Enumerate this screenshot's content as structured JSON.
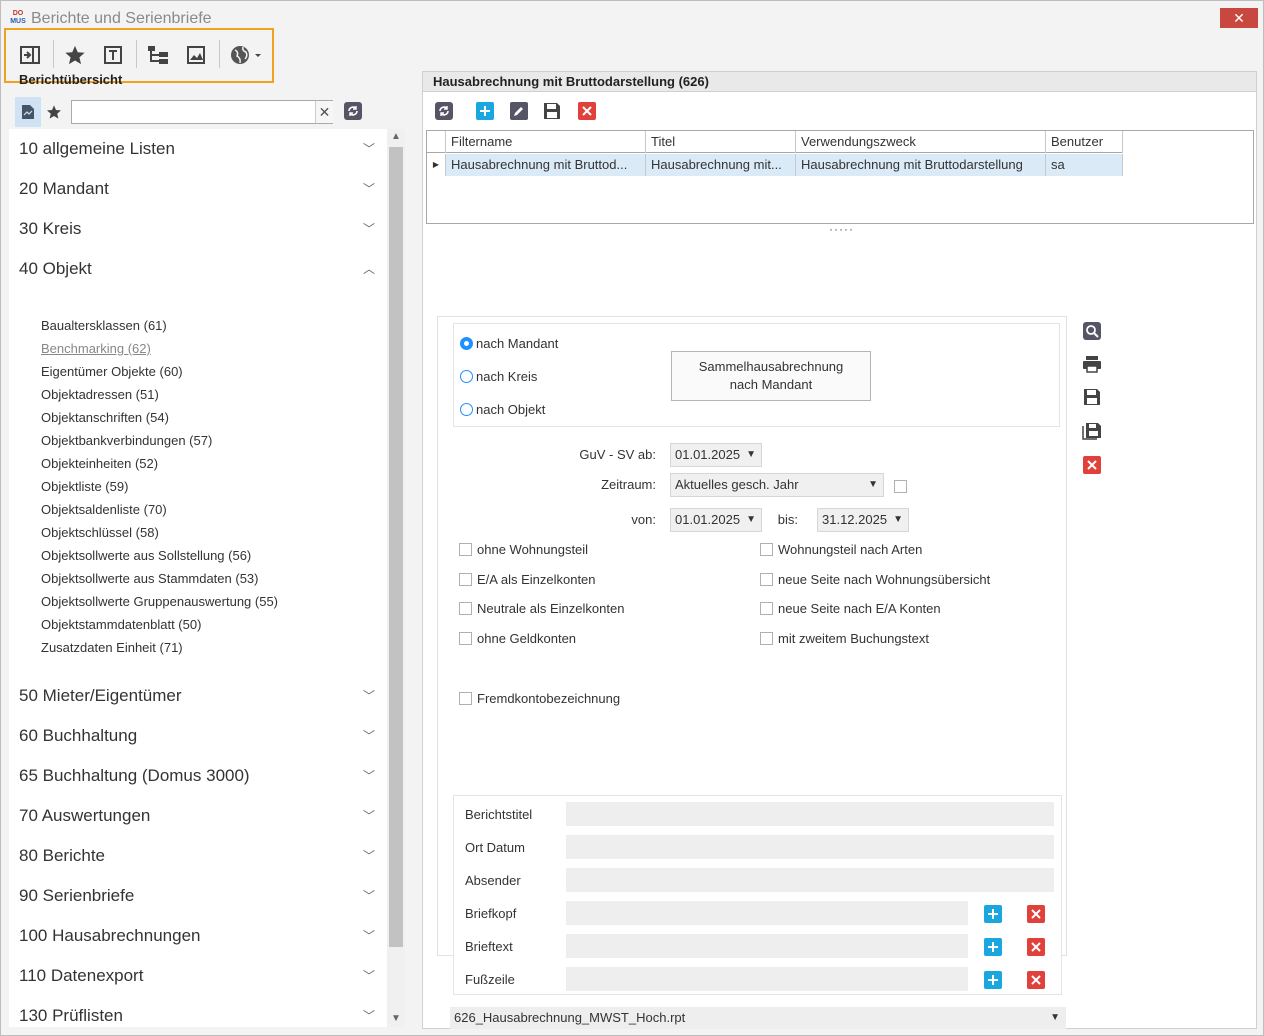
{
  "window": {
    "title": "Berichte und Serienbriefe",
    "close_label": "✕"
  },
  "toolbar": {
    "icons": [
      "panel-toggle-icon",
      "favorite-star-icon",
      "text-template-icon",
      "tree-structure-icon",
      "report-image-icon",
      "globe-menu-icon"
    ]
  },
  "left": {
    "header": "Berichtübersicht",
    "search": {
      "value": "",
      "placeholder": ""
    },
    "categories": [
      {
        "label": "10 allgemeine Listen",
        "expanded": false
      },
      {
        "label": "20 Mandant",
        "expanded": false
      },
      {
        "label": "30 Kreis",
        "expanded": false
      },
      {
        "label": "40 Objekt",
        "expanded": true
      },
      {
        "label": "50 Mieter/Eigentümer",
        "expanded": false
      },
      {
        "label": "60 Buchhaltung",
        "expanded": false
      },
      {
        "label": "65 Buchhaltung (Domus 3000)",
        "expanded": false
      },
      {
        "label": "70 Auswertungen",
        "expanded": false
      },
      {
        "label": "80 Berichte",
        "expanded": false
      },
      {
        "label": "90 Serienbriefe",
        "expanded": false
      },
      {
        "label": "100 Hausabrechnungen",
        "expanded": false
      },
      {
        "label": "110 Datenexport",
        "expanded": false
      },
      {
        "label": "130 Prüflisten",
        "expanded": false
      }
    ],
    "objekt_items": [
      "Baualtersklassen (61)",
      "Benchmarking (62)",
      "Eigentümer Objekte (60)",
      "Objektadressen (51)",
      "Objektanschriften (54)",
      "Objektbankverbindungen (57)",
      "Objekteinheiten (52)",
      "Objektliste (59)",
      "Objektsaldenliste (70)",
      "Objektschlüssel (58)",
      "Objektsollwerte aus Sollstellung (56)",
      "Objektsollwerte aus Stammdaten (53)",
      "Objektsollwerte Gruppenauswertung (55)",
      "Objektstammdatenblatt (50)",
      "Zusatzdaten Einheit (71)"
    ]
  },
  "right": {
    "header": "Hausabrechnung mit Bruttodarstellung (626)",
    "grid": {
      "columns": [
        "Filtername",
        "Titel",
        "Verwendungszweck",
        "Benutzer"
      ],
      "rows": [
        [
          "Hausabrechnung mit Bruttod...",
          "Hausabrechnung mit...",
          "Hausabrechnung mit Bruttodarstellung",
          "sa"
        ]
      ]
    },
    "splitter": "·····",
    "radios": [
      {
        "label": "nach Mandant",
        "checked": true
      },
      {
        "label": "nach Kreis",
        "checked": false
      },
      {
        "label": "nach Objekt",
        "checked": false
      }
    ],
    "sammel_button": [
      "Sammelhausabrechnung",
      "nach Mandant"
    ],
    "guv_label": "GuV - SV ab:",
    "guv_value": "01.01.2025",
    "zeitraum_label": "Zeitraum:",
    "zeitraum_value": "Aktuelles gesch. Jahr",
    "von_label": "von:",
    "von_value": "01.01.2025",
    "bis_label": "bis:",
    "bis_value": "31.12.2025",
    "checkboxes_left": [
      "ohne Wohnungsteil",
      "E/A als Einzelkonten",
      "Neutrale als Einzelkonten",
      "ohne Geldkonten"
    ],
    "checkboxes_right": [
      "Wohnungsteil nach Arten",
      "neue Seite nach Wohnungsübersicht",
      "neue Seite nach E/A Konten",
      "mit zweitem Buchungstext"
    ],
    "fremdkonto": "Fremdkontobezeichnung",
    "doc_fields": [
      "Berichtstitel",
      "Ort Datum",
      "Absender",
      "Briefkopf",
      "Brieftext",
      "Fußzeile"
    ],
    "file": "626_Hausabrechnung_MWST_Hoch.rpt"
  },
  "colors": {
    "accent": "#1e90ff",
    "add": "#1aa7e0",
    "delete": "#e0413a",
    "highlight_border": "#f0a21c"
  }
}
